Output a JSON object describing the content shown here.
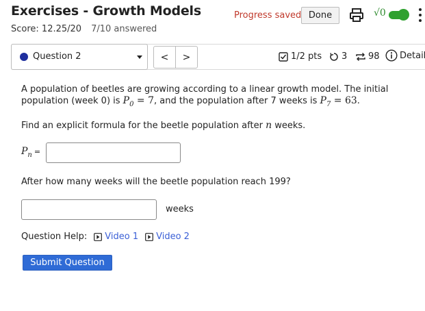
{
  "header": {
    "title": "Exercises - Growth Models",
    "score": "Score: 12.25/20",
    "answered": "7/10 answered",
    "progress_saved": "Progress saved",
    "done_label": "Done",
    "sqrt_label": "√0"
  },
  "question_nav": {
    "selected_question": "Question 2",
    "prev_label": "<",
    "next_label": ">",
    "points": "1/2 pts",
    "retries": "3",
    "attempts": "98",
    "details_label": "Details"
  },
  "question": {
    "intro_a": "A population of beetles are growing according to a linear growth model. The initial population (week 0) is ",
    "p0_sym": "P",
    "p0_sub": "0",
    "p0_val": " = 7",
    "intro_b": ", and the population after 7 weeks is ",
    "p7_sym": "P",
    "p7_sub": "7",
    "p7_val": " = 63",
    "intro_c": ".",
    "part1_a": "Find an explicit formula for the beetle population after ",
    "part1_var": "n",
    "part1_b": " weeks.",
    "pn_sym": "P",
    "pn_sub": "n",
    "pn_eq": "=",
    "pn_value": "",
    "part2": "After how many weeks will the beetle population reach 199?",
    "weeks_value": "",
    "weeks_label": "weeks"
  },
  "help": {
    "label": "Question Help:",
    "video1": "Video 1",
    "video2": "Video 2"
  },
  "submit_label": "Submit Question",
  "colors": {
    "accent": "#2f6bd6",
    "link": "#3a5fd6",
    "saved": "#c0392b",
    "toggle": "#2fa12f",
    "question_dot": "#1f2f9e"
  }
}
